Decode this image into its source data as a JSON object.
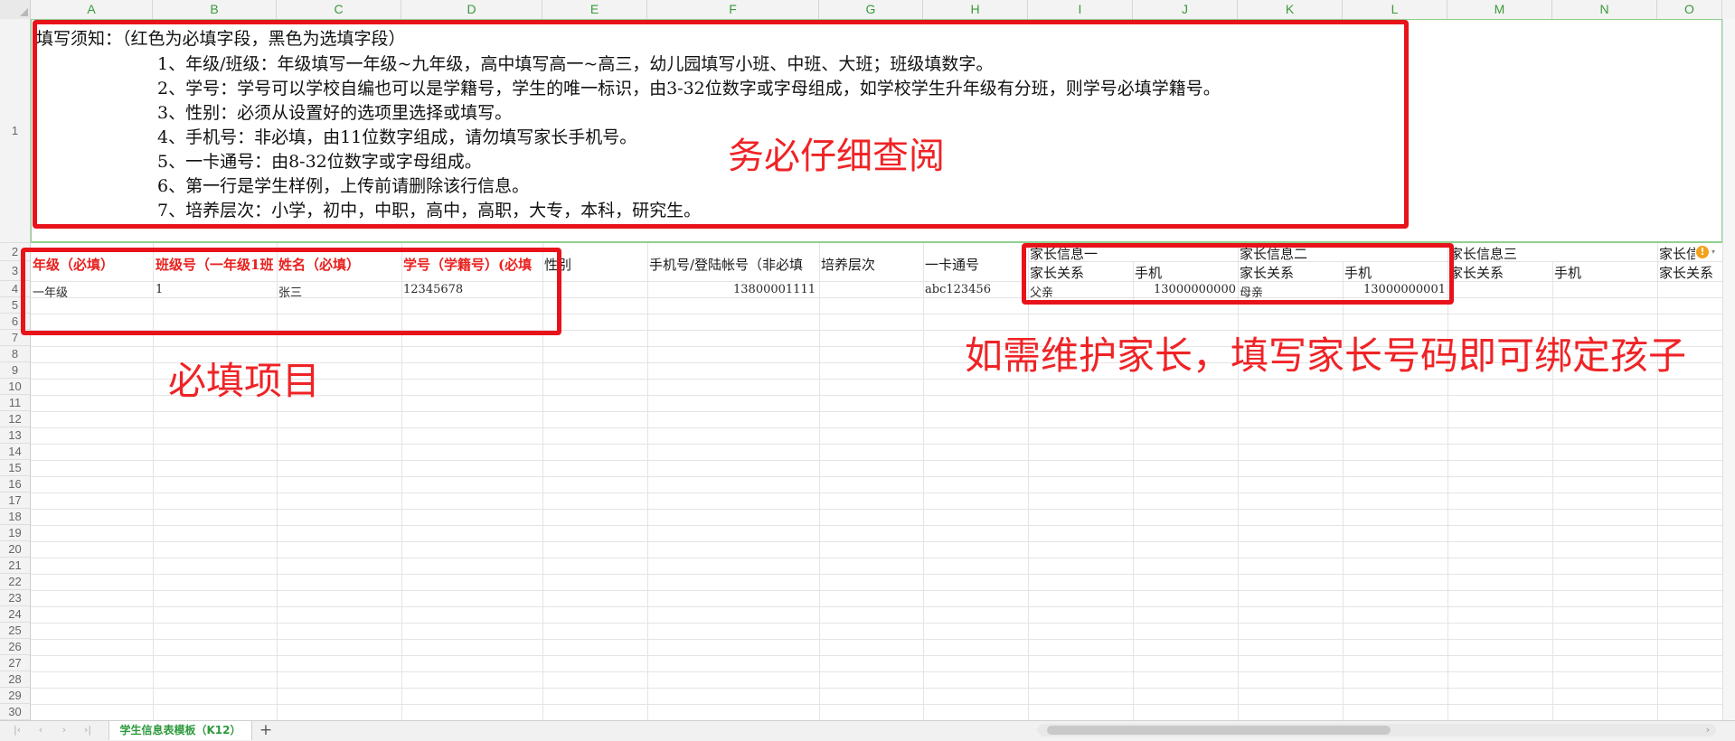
{
  "spreadsheet": {
    "columns": [
      "A",
      "B",
      "C",
      "D",
      "E",
      "F",
      "G",
      "H",
      "I",
      "J",
      "K",
      "L",
      "M",
      "N",
      "O"
    ],
    "rows": [
      "1",
      "2",
      "3",
      "4",
      "5",
      "6",
      "7",
      "8",
      "9",
      "10",
      "11",
      "12",
      "13",
      "14",
      "15",
      "16",
      "17",
      "18",
      "19",
      "20",
      "21",
      "22",
      "23",
      "24",
      "25",
      "26",
      "27",
      "28",
      "29",
      "30"
    ]
  },
  "notice": {
    "title": "填写须知：（红色为必填字段，黑色为选填字段）",
    "items": [
      "1、年级/班级：年级填写一年级~九年级，高中填写高一~高三，幼儿园填写小班、中班、大班；班级填数字。",
      "2、学号：学号可以学校自编也可以是学籍号，学生的唯一标识，由3-32位数字或字母组成，如学校学生升年级有分班，则学号必填学籍号。",
      "3、性别：必须从设置好的选项里选择或填写。",
      "4、手机号：非必填，由11位数字组成，请勿填写家长手机号。",
      "5、一卡通号：由8-32位数字或字母组成。",
      "6、第一行是学生样例，上传前请删除该行信息。",
      "7、培养层次：小学，初中，中职，高中，高职，大专，本科，研究生。"
    ]
  },
  "headers": {
    "grade": "年级（必填）",
    "class": "班级号（一年级1班",
    "name": "姓名（必填）",
    "student_id": "学号（学籍号）(必填",
    "gender": "性别",
    "phone": "手机号/登陆帐号（非必填",
    "level": "培养层次",
    "card": "一卡通号",
    "parent1": "家长信息一",
    "parent2": "家长信息二",
    "parent3": "家长信息三",
    "parent4": "家长信",
    "relation": "家长关系",
    "mobile": "手机"
  },
  "sample_row": {
    "grade": "一年级",
    "class": "1",
    "name": "张三",
    "student_id": "12345678",
    "phone": "13800001111",
    "card": "abc123456",
    "p1_relation": "父亲",
    "p1_phone": "13000000000",
    "p2_relation": "母亲",
    "p2_phone": "13000000001"
  },
  "annotations": {
    "review": "务必仔细查阅",
    "required": "必填项目",
    "parent_hint": "如需维护家长，填写家长号码即可绑定孩子"
  },
  "sheet_bar": {
    "tab_label": "学生信息表模板（K12）",
    "add_label": "+"
  },
  "colors": {
    "required_text": "#e8201d",
    "annotation": "#ef2326",
    "sheet_tab_text": "#2e9a3c",
    "column_header_text": "#3a9a3a"
  }
}
